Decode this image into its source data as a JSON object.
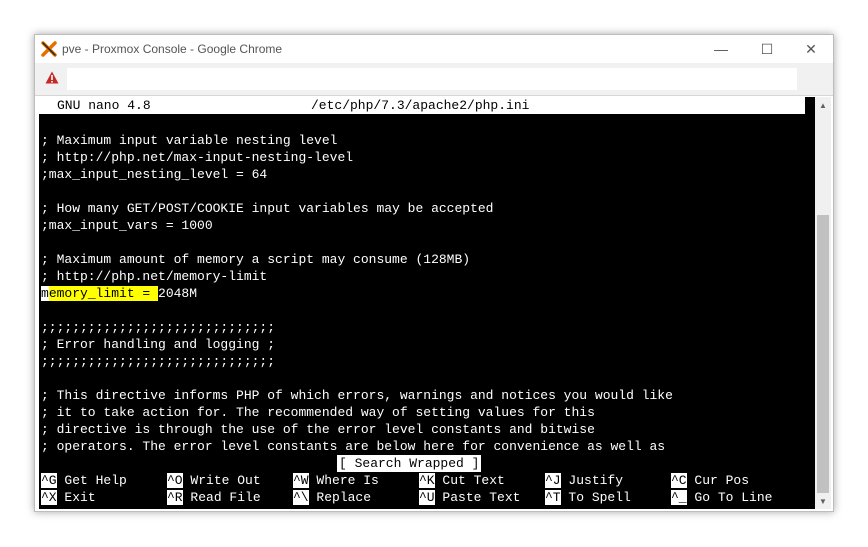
{
  "window": {
    "title": "pve - Proxmox Console - Google Chrome",
    "controls": {
      "minimize": "—",
      "maximize": "☐",
      "close": "✕"
    }
  },
  "nano": {
    "version": "GNU nano 4.8",
    "filename": "/etc/php/7.3/apache2/php.ini",
    "lines": [
      "; Maximum input variable nesting level",
      "; http://php.net/max-input-nesting-level",
      ";max_input_nesting_level = 64",
      "",
      "; How many GET/POST/COOKIE input variables may be accepted",
      ";max_input_vars = 1000",
      "",
      "; Maximum amount of memory a script may consume (128MB)",
      "; http://php.net/memory-limit",
      "",
      "",
      ";;;;;;;;;;;;;;;;;;;;;;;;;;;;;;",
      "; Error handling and logging ;",
      ";;;;;;;;;;;;;;;;;;;;;;;;;;;;;;",
      "",
      "; This directive informs PHP of which errors, warnings and notices you would like",
      "; it to take action for. The recommended way of setting values for this",
      "; directive is through the use of the error level constants and bitwise",
      "; operators. The error level constants are below here for convenience as well as"
    ],
    "memory_line": {
      "cursor_char": "m",
      "highlight_rest": "emory_limit = ",
      "value": "2048M"
    },
    "status": "[ Search Wrapped ]",
    "shortcuts": [
      {
        "key": "^G",
        "label": "Get Help"
      },
      {
        "key": "^O",
        "label": "Write Out"
      },
      {
        "key": "^W",
        "label": "Where Is"
      },
      {
        "key": "^K",
        "label": "Cut Text"
      },
      {
        "key": "^J",
        "label": "Justify"
      },
      {
        "key": "^C",
        "label": "Cur Pos"
      },
      {
        "key": "^X",
        "label": "Exit"
      },
      {
        "key": "^R",
        "label": "Read File"
      },
      {
        "key": "^\\",
        "label": "Replace"
      },
      {
        "key": "^U",
        "label": "Paste Text"
      },
      {
        "key": "^T",
        "label": "To Spell"
      },
      {
        "key": "^_",
        "label": "Go To Line"
      }
    ]
  },
  "scrollbar": {
    "up": "▲",
    "down": "▼"
  },
  "colors": {
    "terminal_bg": "#000000",
    "terminal_fg": "#ffffff",
    "highlight": "#ffff00",
    "app_icon": "#e57000"
  },
  "icons": [
    "proxmox-logo-icon",
    "warning-icon",
    "text-cursor-icon"
  ]
}
